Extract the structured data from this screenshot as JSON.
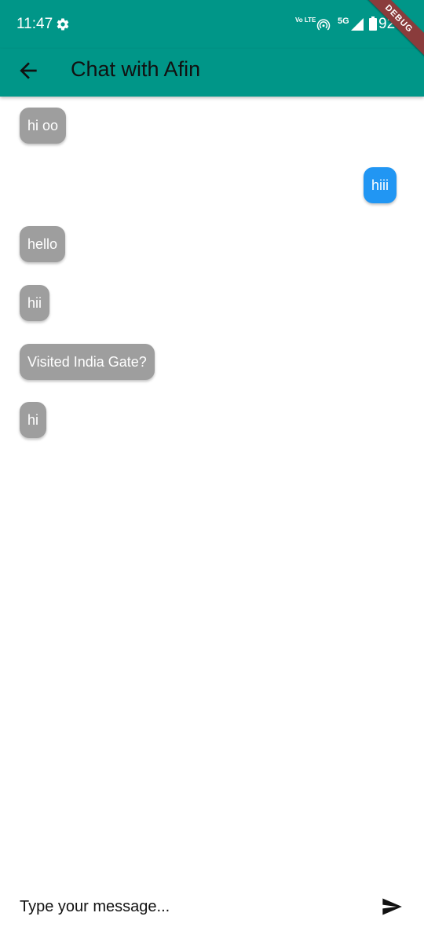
{
  "status_bar": {
    "time": "11:47",
    "network_volte": "Vo LTE",
    "network_type": "5G",
    "battery": "92",
    "icons": [
      "settings-gear-icon",
      "hotspot-icon",
      "signal-icon",
      "battery-icon"
    ]
  },
  "debug_banner": "DEBUG",
  "app_bar": {
    "title": "Chat with Afin",
    "back_icon": "arrow-back-icon"
  },
  "messages": [
    {
      "text": "hi oo",
      "direction": "received"
    },
    {
      "text": "hiii",
      "direction": "sent"
    },
    {
      "text": "hello",
      "direction": "received"
    },
    {
      "text": "hii",
      "direction": "received"
    },
    {
      "text": "Visited India Gate?",
      "direction": "received"
    },
    {
      "text": "hi",
      "direction": "received"
    }
  ],
  "input": {
    "placeholder": "Type your message...",
    "value": "",
    "send_icon": "send-icon"
  },
  "colors": {
    "app_bar": "#009688",
    "received_bubble": "#9e9e9e",
    "sent_bubble": "#2196f3",
    "background": "#ffffff"
  }
}
